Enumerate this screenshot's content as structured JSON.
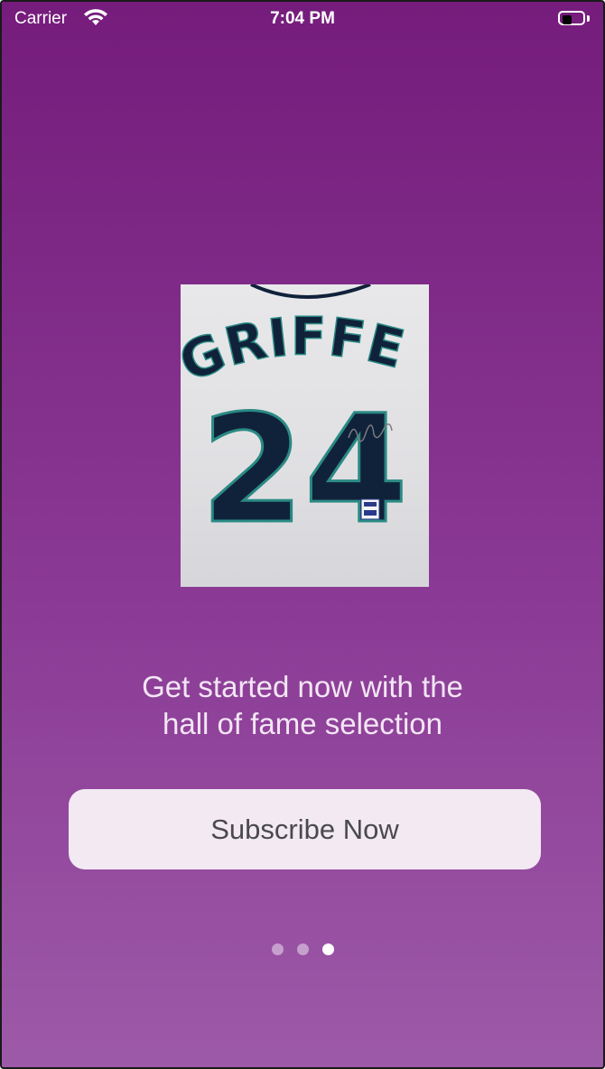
{
  "status_bar": {
    "carrier": "Carrier",
    "time": "7:04 PM"
  },
  "hero_image": {
    "jersey_name": "GRIFFEY",
    "jersey_number": "24",
    "icon": "jersey-photo"
  },
  "headline": {
    "line1": "Get started now with the",
    "line2": "hall of fame selection"
  },
  "subscribe_button": {
    "label": "Subscribe Now"
  },
  "page_control": {
    "total": 3,
    "current": 3
  },
  "colors": {
    "background_top": "#751c7c",
    "background_bottom": "#9d5aa8",
    "button_bg": "#f2e9f3",
    "jersey_navy": "#10223a",
    "jersey_teal": "#2a8a84"
  }
}
